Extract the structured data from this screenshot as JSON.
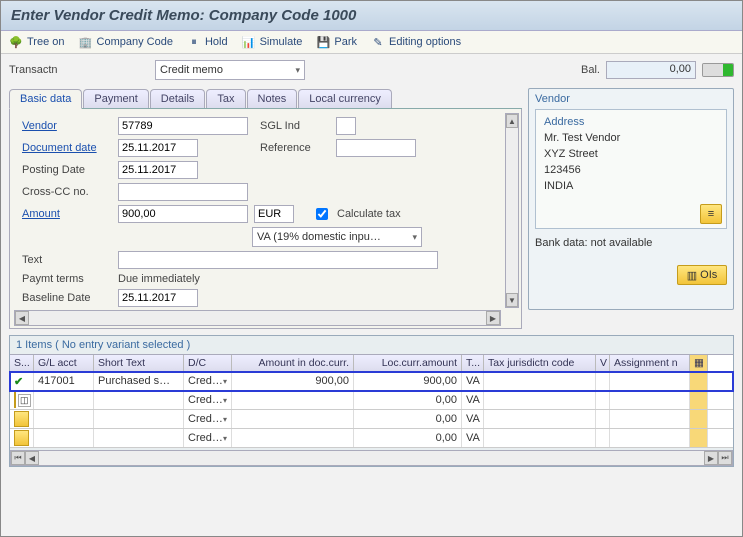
{
  "title": "Enter Vendor Credit Memo: Company Code 1000",
  "toolbar": {
    "tree_on": "Tree on",
    "company_code": "Company Code",
    "hold": "Hold",
    "simulate": "Simulate",
    "park": "Park",
    "editing_options": "Editing options"
  },
  "transaction": {
    "label": "Transactn",
    "value": "Credit memo"
  },
  "balance": {
    "label": "Bal.",
    "value": "0,00"
  },
  "tabs": {
    "basic": "Basic data",
    "payment": "Payment",
    "details": "Details",
    "tax": "Tax",
    "notes": "Notes",
    "local": "Local currency"
  },
  "form": {
    "vendor_label": "Vendor",
    "vendor": "57789",
    "sgl_label": "SGL Ind",
    "sgl": "",
    "docdate_label": "Document date",
    "docdate": "25.11.2017",
    "ref_label": "Reference",
    "ref": "",
    "postdate_label": "Posting Date",
    "postdate": "25.11.2017",
    "crosscc_label": "Cross-CC no.",
    "crosscc": "",
    "amount_label": "Amount",
    "amount": "900,00",
    "currency": "EUR",
    "calc_tax_label": "Calculate tax",
    "tax_code": "VA (19% domestic inpu…",
    "text_label": "Text",
    "text": "",
    "paymt_label": "Paymt terms",
    "paymt": "Due immediately",
    "baseline_label": "Baseline Date",
    "baseline": "25.11.2017"
  },
  "vendor_box": {
    "title": "Vendor",
    "address_title": "Address",
    "lines": [
      "Mr. Test Vendor",
      "XYZ Street",
      "123456",
      "INDIA"
    ],
    "bank": "Bank data: not available",
    "ois": "OIs"
  },
  "items": {
    "header": "1 Items ( No entry variant selected )",
    "cols": {
      "s": "S...",
      "gl": "G/L acct",
      "st": "Short Text",
      "dc": "D/C",
      "am": "Amount in doc.curr.",
      "lc": "Loc.curr.amount",
      "tx": "T...",
      "tj": "Tax jurisdictn code",
      "v": "V",
      "as": "Assignment n"
    },
    "rows": [
      {
        "sel": true,
        "gl": "417001",
        "st": "Purchased s…",
        "dc": "Cred…",
        "am": "900,00",
        "lc": "900,00",
        "tx": "VA",
        "tj": "",
        "v": "",
        "as": ""
      },
      {
        "sel": false,
        "gl": "",
        "st": "",
        "dc": "Cred…",
        "am": "",
        "lc": "0,00",
        "tx": "VA",
        "tj": "",
        "v": "",
        "as": ""
      },
      {
        "sel": false,
        "gl": "",
        "st": "",
        "dc": "Cred…",
        "am": "",
        "lc": "0,00",
        "tx": "VA",
        "tj": "",
        "v": "",
        "as": ""
      },
      {
        "sel": false,
        "gl": "",
        "st": "",
        "dc": "Cred…",
        "am": "",
        "lc": "0,00",
        "tx": "VA",
        "tj": "",
        "v": "",
        "as": ""
      }
    ]
  }
}
